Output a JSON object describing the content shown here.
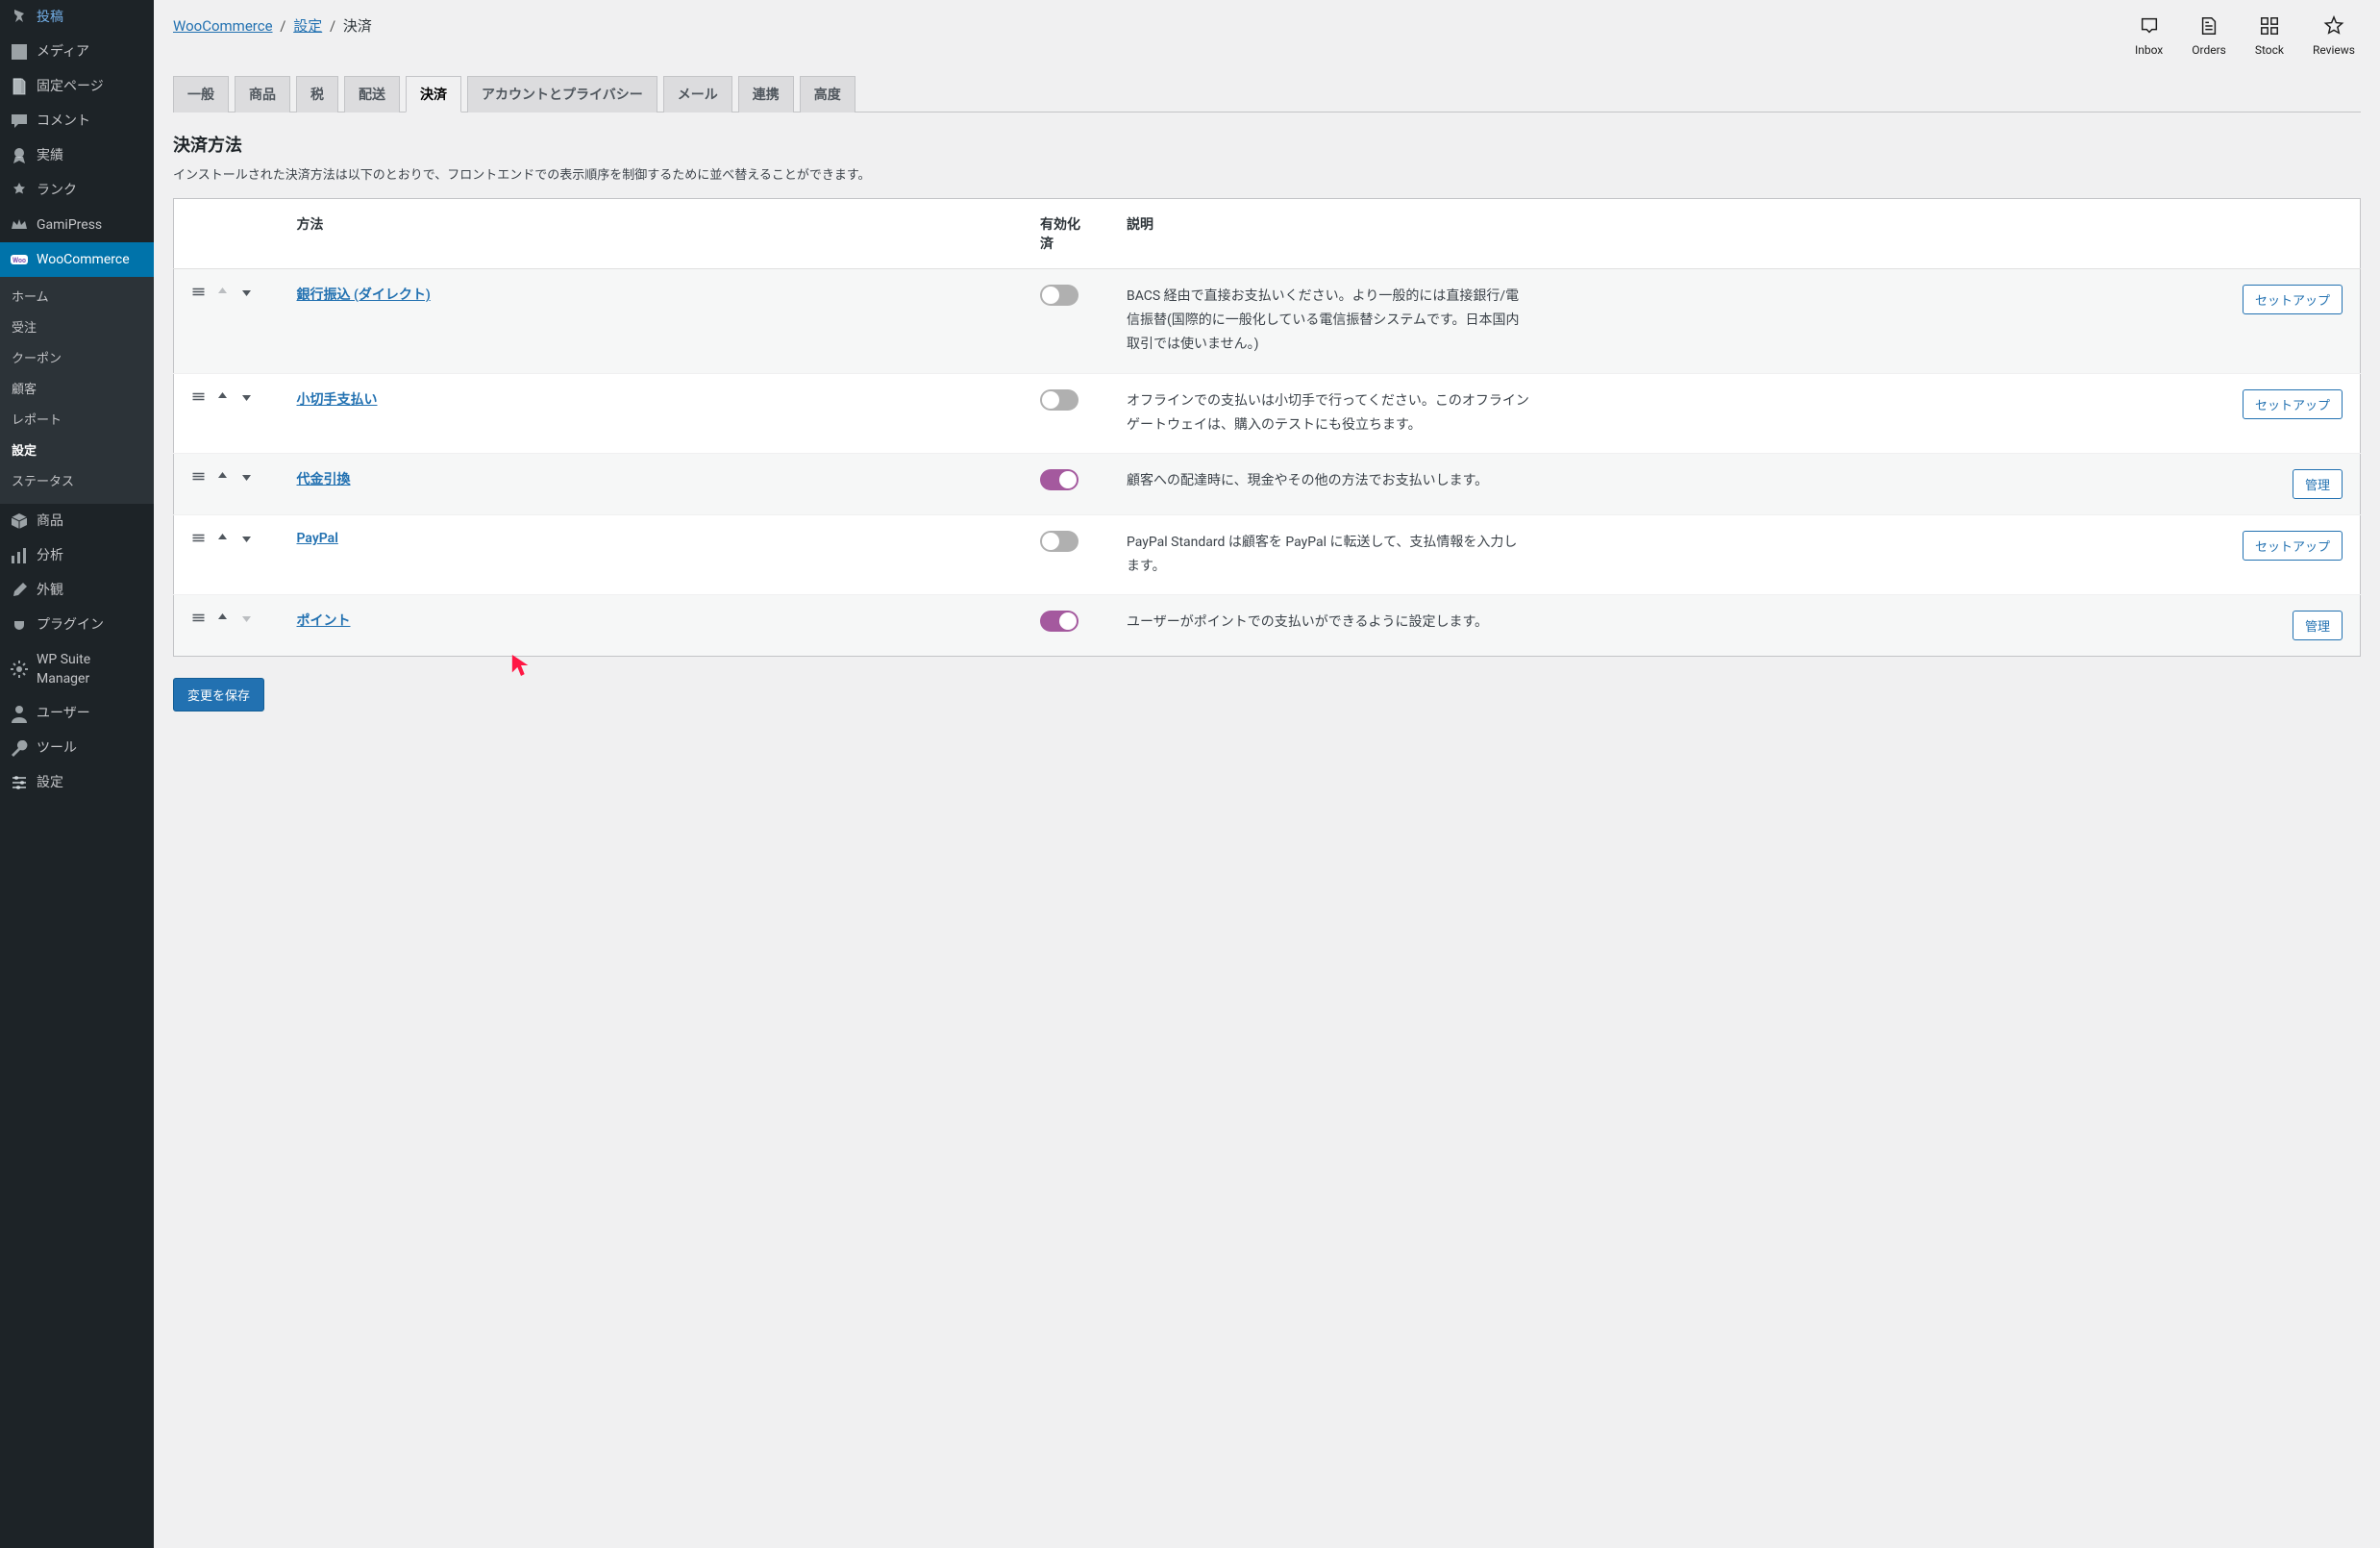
{
  "sidebar": {
    "items": [
      {
        "name": "posts",
        "label": "投稿",
        "icon": "pin"
      },
      {
        "name": "media",
        "label": "メディア",
        "icon": "media"
      },
      {
        "name": "pages",
        "label": "固定ページ",
        "icon": "pages"
      },
      {
        "name": "comments",
        "label": "コメント",
        "icon": "comment"
      },
      {
        "name": "achievements",
        "label": "実績",
        "icon": "award"
      },
      {
        "name": "rank",
        "label": "ランク",
        "icon": "rank"
      },
      {
        "name": "gamipress",
        "label": "GamiPress",
        "icon": "crown"
      },
      {
        "name": "woocommerce",
        "label": "WooCommerce",
        "icon": "woo",
        "current": true
      },
      {
        "name": "products",
        "label": "商品",
        "icon": "box"
      },
      {
        "name": "analytics",
        "label": "分析",
        "icon": "bars"
      },
      {
        "name": "appearance",
        "label": "外観",
        "icon": "brush"
      },
      {
        "name": "plugins",
        "label": "プラグイン",
        "icon": "plug"
      },
      {
        "name": "wpsuite",
        "label": "WP Suite Manager",
        "icon": "gear"
      },
      {
        "name": "users",
        "label": "ユーザー",
        "icon": "user"
      },
      {
        "name": "tools",
        "label": "ツール",
        "icon": "wrench"
      },
      {
        "name": "settings",
        "label": "設定",
        "icon": "sliders"
      }
    ],
    "woo_submenu": {
      "home": "ホーム",
      "orders": "受注",
      "coupons": "クーポン",
      "customers": "顧客",
      "reports": "レポート",
      "settings": "設定",
      "status": "ステータス"
    }
  },
  "breadcrumbs": {
    "woocommerce": "WooCommerce",
    "settings": "設定",
    "current": "決済",
    "sep": "/"
  },
  "activity": {
    "inbox": "Inbox",
    "orders": "Orders",
    "stock": "Stock",
    "reviews": "Reviews"
  },
  "tabs": {
    "general": "一般",
    "products": "商品",
    "tax": "税",
    "shipping": "配送",
    "checkout": "決済",
    "accounts": "アカウントとプライバシー",
    "emails": "メール",
    "integration": "連携",
    "advanced": "高度"
  },
  "section": {
    "title": "決済方法",
    "description": "インストールされた決済方法は以下のとおりで、フロントエンドでの表示順序を制御するために並べ替えることができます。"
  },
  "table": {
    "headers": {
      "method": "方法",
      "enabled": "有効化済",
      "description": "説明"
    },
    "buttons": {
      "setup": "セットアップ",
      "manage": "管理"
    },
    "rows": [
      {
        "id": "bacs",
        "name": "銀行振込 (ダイレクト)",
        "enabled": false,
        "description": "BACS 経由で直接お支払いください。より一般的には直接銀行/電信振替(国際的に一般化している電信振替システムです。日本国内取引では使いません。)",
        "action": "setup",
        "canMoveUp": false,
        "canMoveDown": true
      },
      {
        "id": "cheque",
        "name": "小切手支払い",
        "enabled": false,
        "description": "オフラインでの支払いは小切手で行ってください。このオフラインゲートウェイは、購入のテストにも役立ちます。",
        "action": "setup",
        "canMoveUp": true,
        "canMoveDown": true
      },
      {
        "id": "cod",
        "name": "代金引換",
        "enabled": true,
        "description": "顧客への配達時に、現金やその他の方法でお支払いします。",
        "action": "manage",
        "canMoveUp": true,
        "canMoveDown": true
      },
      {
        "id": "paypal",
        "name": "PayPal",
        "enabled": false,
        "description": "PayPal Standard は顧客を PayPal に転送して、支払情報を入力します。",
        "action": "setup",
        "canMoveUp": true,
        "canMoveDown": true
      },
      {
        "id": "points",
        "name": "ポイント",
        "enabled": true,
        "description": "ユーザーがポイントでの支払いができるように設定します。",
        "action": "manage",
        "canMoveUp": true,
        "canMoveDown": false
      }
    ]
  },
  "save_button": "変更を保存"
}
